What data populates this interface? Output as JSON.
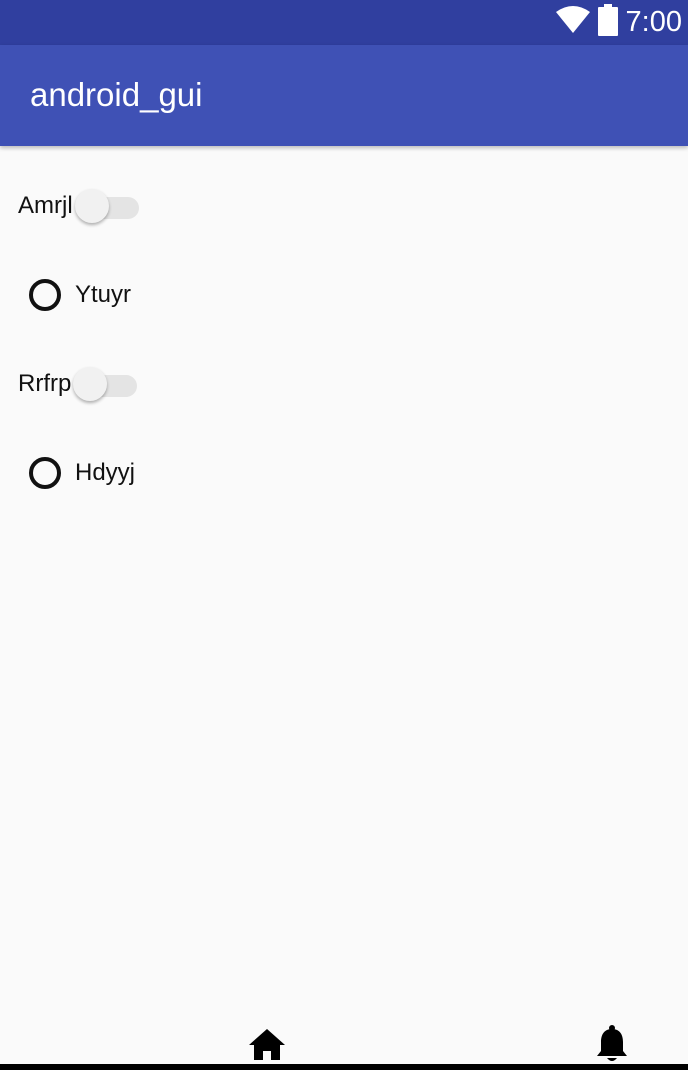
{
  "status_bar": {
    "time": "7:00",
    "icons": [
      "wifi-icon",
      "battery-icon"
    ]
  },
  "app_bar": {
    "title": "android_gui"
  },
  "controls": [
    {
      "type": "switch",
      "label": "Amrjl",
      "checked": false
    },
    {
      "type": "radio",
      "label": "Ytuyr",
      "checked": false
    },
    {
      "type": "switch",
      "label": "Rrfrp",
      "checked": false
    },
    {
      "type": "radio",
      "label": "Hdyyj",
      "checked": false
    }
  ],
  "bottom_nav": {
    "icons": [
      "home-icon",
      "bell-icon"
    ]
  },
  "colors": {
    "status_bar": "#303f9f",
    "app_bar": "#3f51b5",
    "background": "#fafafa"
  }
}
